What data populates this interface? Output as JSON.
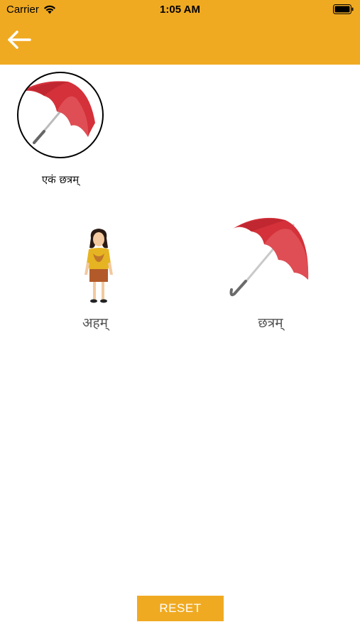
{
  "status_bar": {
    "carrier": "Carrier",
    "time": "1:05 AM",
    "wifi_icon": "wifi-icon",
    "battery_icon": "battery-icon"
  },
  "header": {
    "back_icon": "arrow-left-icon",
    "color": "#F0AA22"
  },
  "selection": {
    "image": "umbrella",
    "label": "एकं छत्रम्"
  },
  "options": [
    {
      "image": "girl",
      "label": "अहम्"
    },
    {
      "image": "umbrella",
      "label": "छत्रम्"
    }
  ],
  "footer": {
    "reset_label": "RESET",
    "button_color": "#F0AA22"
  }
}
